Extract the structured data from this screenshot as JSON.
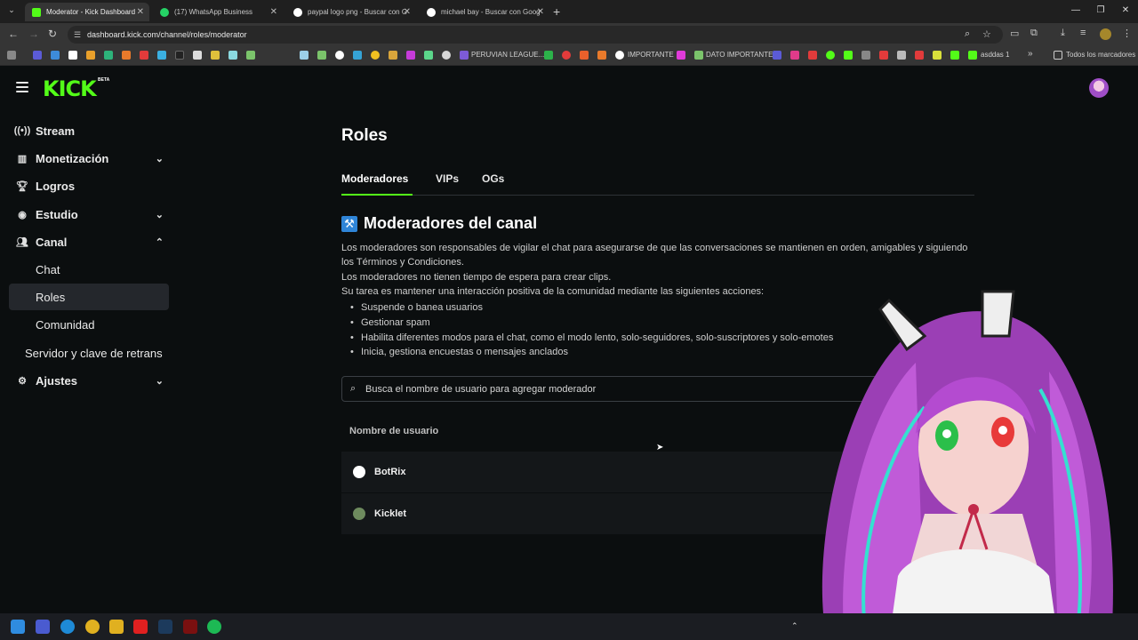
{
  "browser": {
    "tabs": [
      {
        "title": "Moderator - Kick Dashboard",
        "active": true,
        "icon": "kick-icon",
        "color": "#53fc18"
      },
      {
        "title": "(17) WhatsApp Business",
        "active": false,
        "icon": "whatsapp-icon",
        "color": "#25d366"
      },
      {
        "title": "paypal logo png - Buscar con G",
        "active": false,
        "icon": "google-icon",
        "color": "#ffffff"
      },
      {
        "title": "michael bay - Buscar con Goog",
        "active": false,
        "icon": "google-icon",
        "color": "#ffffff"
      }
    ],
    "url": "dashboard.kick.com/channel/roles/moderator",
    "bookmarks": {
      "labels": [
        "PERUVIAN LEAGUE...",
        "IMPORTANTE",
        "DATO IMPORTANTE",
        "asddas 1"
      ],
      "all_bookmarks": "Todos los marcadores"
    }
  },
  "app": {
    "logo": "KICK",
    "beta": "BETA"
  },
  "sidebar": {
    "items": [
      {
        "label": "Stream",
        "icon": "broadcast-icon"
      },
      {
        "label": "Monetización",
        "icon": "chart-icon",
        "chevron": "down"
      },
      {
        "label": "Logros",
        "icon": "trophy-icon"
      },
      {
        "label": "Estudio",
        "icon": "studio-icon",
        "chevron": "down"
      },
      {
        "label": "Canal",
        "icon": "people-icon",
        "chevron": "up"
      },
      {
        "label": "Chat",
        "sub": true
      },
      {
        "label": "Roles",
        "sub": true,
        "selected": true
      },
      {
        "label": "Comunidad",
        "sub": true
      },
      {
        "label": "Servidor y clave de retrans"
      },
      {
        "label": "Ajustes",
        "icon": "gear-icon",
        "chevron": "down"
      }
    ]
  },
  "main": {
    "title": "Roles",
    "tabs": [
      "Moderadores",
      "VIPs",
      "OGs"
    ],
    "section_title": "Moderadores del canal",
    "description": [
      "Los moderadores son responsables de vigilar el chat para asegurarse de que las conversaciones se mantienen en orden, amigables y siguiendo los Términos y Condiciones.",
      "Los moderadores no tienen tiempo de espera para crear clips.",
      "Su tarea es mantener una interacción positiva de la comunidad mediante las siguientes acciones:"
    ],
    "bullets": [
      "Suspende o banea usuarios",
      "Gestionar spam",
      "Habilita diferentes modos para el chat, como el modo lento, solo-seguidores, solo-suscriptores y solo-emotes",
      "Inicia, gestiona encuestas o mensajes anclados"
    ],
    "search_placeholder": "Busca el nombre de usuario para agregar moderador",
    "table": {
      "header": "Nombre de usuario",
      "rows": [
        {
          "username": "BotRix",
          "icon": "botrix-icon"
        },
        {
          "username": "Kicklet",
          "icon": "kicklet-icon"
        }
      ]
    }
  },
  "colors": {
    "accent": "#53fc18",
    "background": "#0b0e0f",
    "row_bg": "#141719",
    "selected_bg": "#24272c",
    "section_icon": "#2f85d8"
  }
}
